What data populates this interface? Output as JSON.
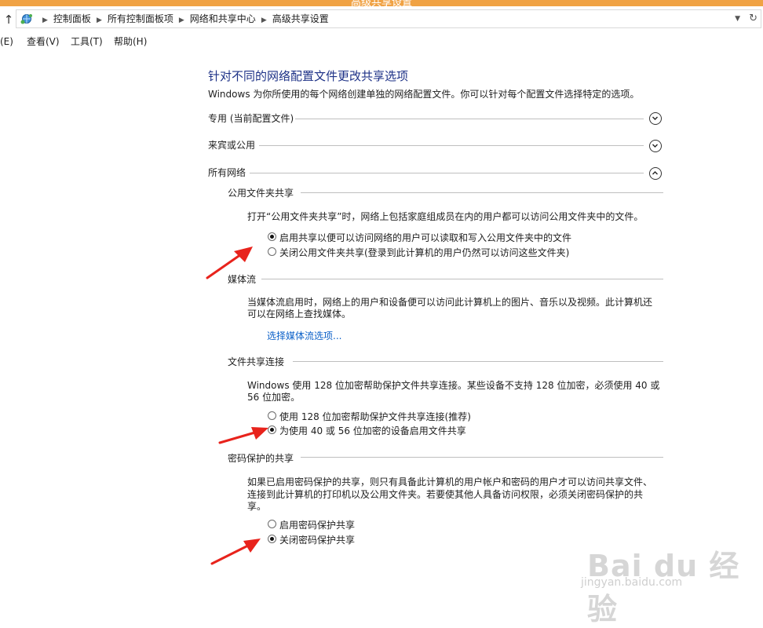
{
  "window": {
    "title": "高级共享设置"
  },
  "address_bar": {
    "crumbs": [
      "控制面板",
      "所有控制面板项",
      "网络和共享中心",
      "高级共享设置"
    ]
  },
  "menu": [
    "(E)",
    "查看(V)",
    "工具(T)",
    "帮助(H)"
  ],
  "page": {
    "title": "针对不同的网络配置文件更改共享选项",
    "description": "Windows 为你所使用的每个网络创建单独的网络配置文件。你可以针对每个配置文件选择特定的选项。",
    "profiles": [
      {
        "label": "专用 (当前配置文件)",
        "expanded": false
      },
      {
        "label": "来宾或公用",
        "expanded": false
      },
      {
        "label": "所有网络",
        "expanded": true
      }
    ]
  },
  "sections": {
    "public_folder": {
      "heading": "公用文件夹共享",
      "desc": "打开“公用文件夹共享”时，网络上包括家庭组成员在内的用户都可以访问公用文件夹中的文件。",
      "options": [
        {
          "label": "启用共享以便可以访问网络的用户可以读取和写入公用文件夹中的文件",
          "checked": true
        },
        {
          "label": "关闭公用文件夹共享(登录到此计算机的用户仍然可以访问这些文件夹)",
          "checked": false
        }
      ]
    },
    "media": {
      "heading": "媒体流",
      "desc_line1": "当媒体流启用时，网络上的用户和设备便可以访问此计算机上的图片、音乐以及视频。此计算机还",
      "desc_line2": "可以在网络上查找媒体。",
      "link": "选择媒体流选项..."
    },
    "file_sharing": {
      "heading": "文件共享连接",
      "desc_line1": "Windows 使用 128 位加密帮助保护文件共享连接。某些设备不支持 128 位加密，必须使用 40 或",
      "desc_line2": "56 位加密。",
      "options": [
        {
          "label": "使用 128 位加密帮助保护文件共享连接(推荐)",
          "checked": false
        },
        {
          "label": "为使用 40 或 56 位加密的设备启用文件共享",
          "checked": true
        }
      ]
    },
    "password": {
      "heading": "密码保护的共享",
      "desc_line1": "如果已启用密码保护的共享，则只有具备此计算机的用户帐户和密码的用户才可以访问共享文件、",
      "desc_line2": "连接到此计算机的打印机以及公用文件夹。若要使其他人具备访问权限，必须关闭密码保护的共",
      "desc_line3": "享。",
      "options": [
        {
          "label": "启用密码保护共享",
          "checked": false
        },
        {
          "label": "关闭密码保护共享",
          "checked": true
        }
      ]
    }
  },
  "watermark": {
    "brand": "Bai du 经验",
    "url": "jingyan.baidu.com"
  },
  "colors": {
    "title_blue": "#1e3287",
    "link_blue": "#0b60c8",
    "arrow_red": "#e8231c",
    "titlebar_orange": "#f0a244"
  }
}
